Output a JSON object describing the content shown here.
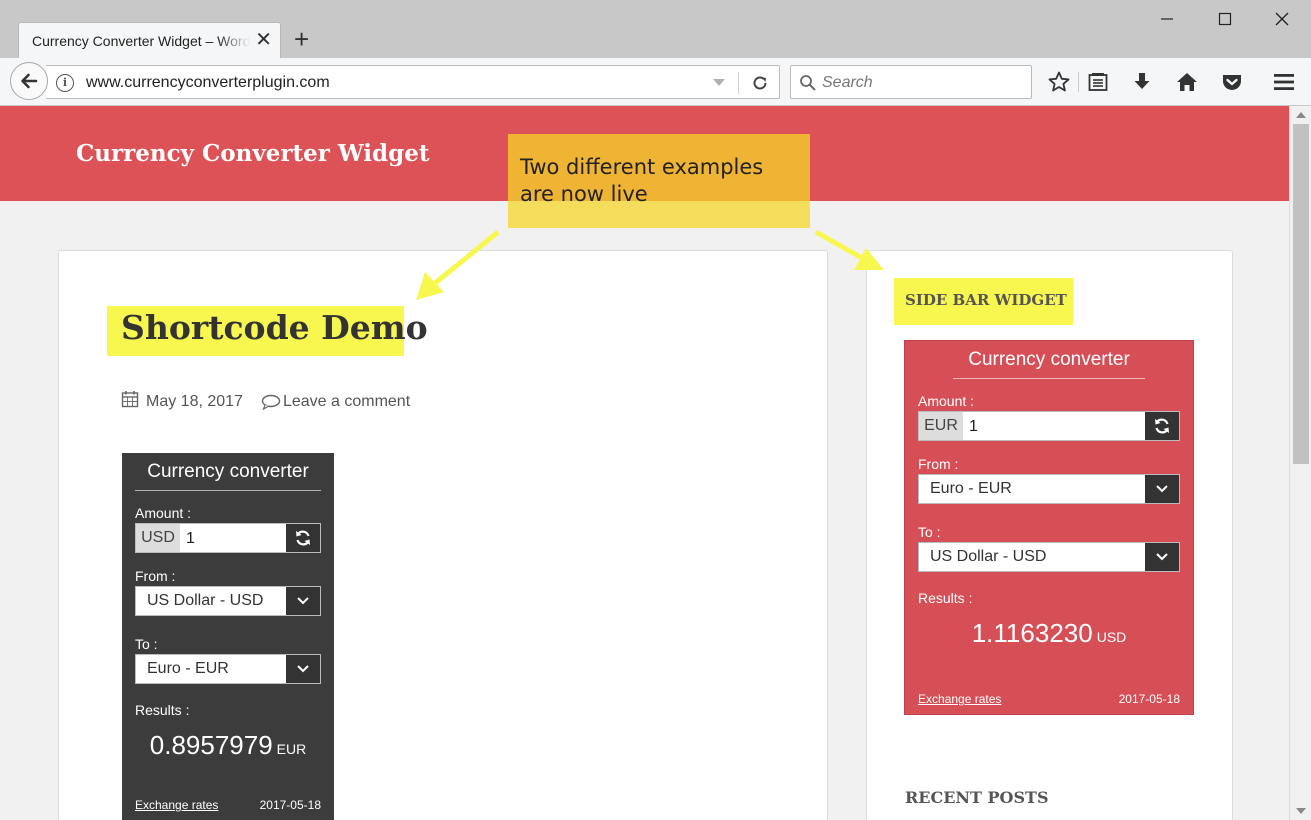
{
  "browser": {
    "tab_title": "Currency Converter Widget – WordPress",
    "new_tab_symbol": "+",
    "close_tab_symbol": "✕",
    "url": "www.currencyconverterplugin.com",
    "search_placeholder": "Search"
  },
  "site": {
    "title": "Currency Converter Widget"
  },
  "post": {
    "title": "Shortcode Demo",
    "date": "May 18, 2017",
    "comment_link": "Leave a comment"
  },
  "annotation": {
    "line1": "Two different examples",
    "line2": "are now live"
  },
  "shortcode_widget": {
    "title": "Currency converter",
    "amount_label": "Amount :",
    "amount_code": "USD",
    "amount_value": "1",
    "from_label": "From :",
    "from_value": "US Dollar - USD",
    "to_label": "To :",
    "to_value": "Euro - EUR",
    "results_label": "Results :",
    "result_value": "0.8957979",
    "result_currency": "EUR",
    "exchange_rates_link": "Exchange rates",
    "date": "2017-05-18",
    "background": "#3c3c3c"
  },
  "sidebar": {
    "heading": "SIDE BAR WIDGET",
    "recent_posts_heading": "RECENT POSTS"
  },
  "sidebar_widget": {
    "title": "Currency converter",
    "amount_label": "Amount :",
    "amount_code": "EUR",
    "amount_value": "1",
    "from_label": "From :",
    "from_value": "Euro - EUR",
    "to_label": "To :",
    "to_value": "US Dollar - USD",
    "results_label": "Results :",
    "result_value": "1.1163230",
    "result_currency": "USD",
    "exchange_rates_link": "Exchange rates",
    "date": "2017-05-18",
    "background": "#d64f56"
  },
  "colors": {
    "header": "#dd5256",
    "highlight": "#f7f74f",
    "callout": "#f4d528"
  }
}
